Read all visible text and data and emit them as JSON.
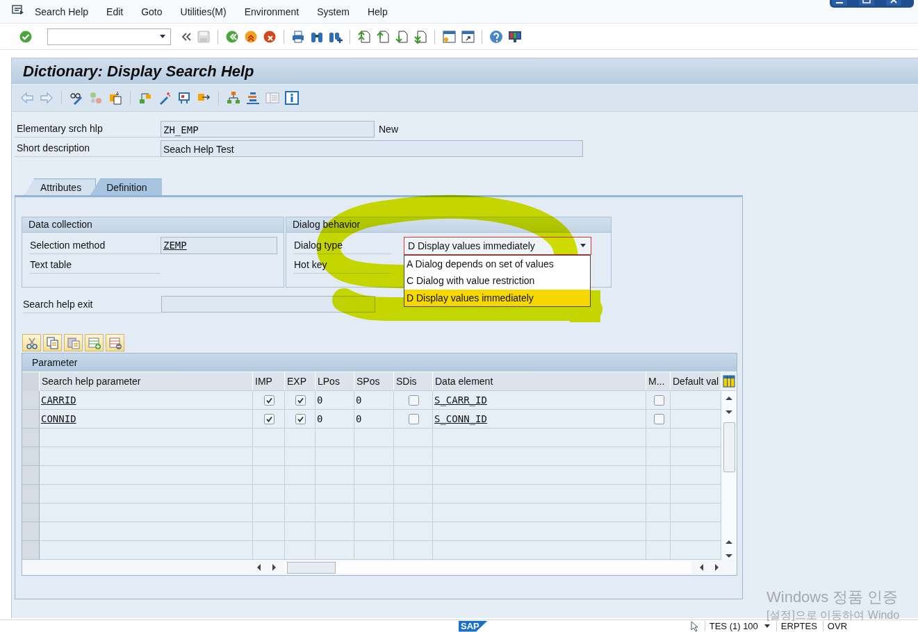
{
  "menu_bar": {
    "items": [
      "Search Help",
      "Edit",
      "Goto",
      "Utilities(M)",
      "Environment",
      "System",
      "Help"
    ]
  },
  "title": "Dictionary: Display Search Help",
  "header_fields": [
    {
      "label": "Elementary srch hlp",
      "value": "ZH_EMP",
      "status": "New"
    },
    {
      "label": "Short description",
      "value": "Seach Help Test"
    }
  ],
  "tabs": [
    {
      "label": "Attributes",
      "selected": false
    },
    {
      "label": "Definition",
      "selected": true
    }
  ],
  "data_collection": {
    "title": "Data collection",
    "fields": [
      {
        "label": "Selection method",
        "value": "ZEMP",
        "kind": "field"
      },
      {
        "label": "Text table",
        "kind": "line"
      }
    ]
  },
  "dialog_behavior": {
    "title": "Dialog behavior",
    "dialog_type": {
      "label": "Dialog type",
      "value": "D Display values immediately",
      "expanded": true,
      "options": [
        {
          "text": "A Dialog depends on set of values",
          "selected": false
        },
        {
          "text": "C Dialog with value restriction",
          "selected": false
        },
        {
          "text": "D Display values immediately",
          "selected": true
        }
      ]
    },
    "hot_key": {
      "label": "Hot key"
    }
  },
  "search_help_exit": {
    "label": "Search help exit"
  },
  "parameters": {
    "title": "Parameter",
    "columns": [
      "Search help parameter",
      "IMP",
      "EXP",
      "LPos",
      "SPos",
      "SDis",
      "Data element",
      "M...",
      "Default val"
    ],
    "rows": [
      {
        "parameter": "CARRID",
        "imp": true,
        "exp": true,
        "lpos": "0",
        "spos": "0",
        "sdis": false,
        "data_element": "S_CARR_ID",
        "m": false
      },
      {
        "parameter": "CONNID",
        "imp": true,
        "exp": true,
        "lpos": "0",
        "spos": "0",
        "sdis": false,
        "data_element": "S_CONN_ID",
        "m": false
      }
    ]
  },
  "status_bar": {
    "logo": "SAP",
    "system": "TES (1) 100",
    "server": "ERPTES",
    "mode": "OVR"
  },
  "os_watermark": [
    "Windows 정품 인증",
    "[설정]으로 이동하여 Windo"
  ]
}
